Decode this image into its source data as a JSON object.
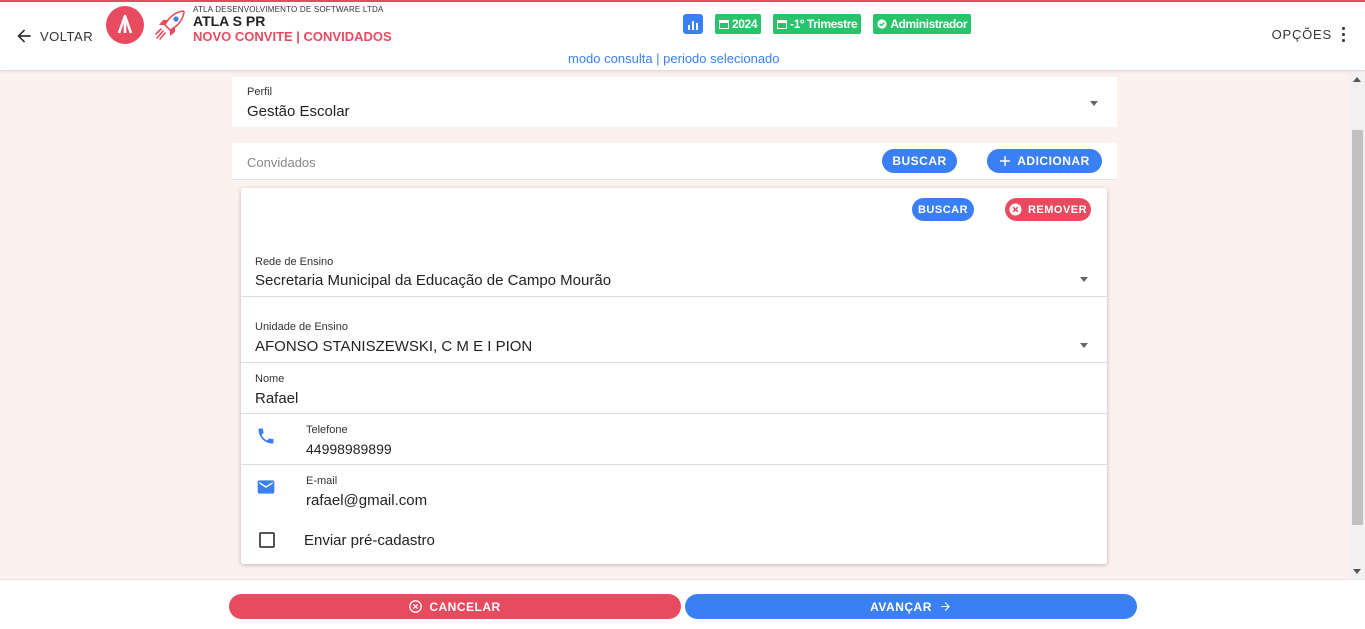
{
  "header": {
    "back_label": "VOLTAR",
    "company": "ATLA DESENVOLVIMENTO DE SOFTWARE LTDA",
    "entity": "ATLA S PR",
    "route": "NOVO CONVITE | CONVIDADOS",
    "badges": {
      "year": "2024",
      "period": "-1º Trimestre",
      "role": "Administrador"
    },
    "mode": "modo consulta | periodo selecionado",
    "options_label": "OPÇÕES"
  },
  "perfil": {
    "label": "Perfil",
    "value": "Gestão Escolar"
  },
  "convidados": {
    "label": "Convidados",
    "search_label": "BUSCAR",
    "add_label": "ADICIONAR"
  },
  "card": {
    "search_label": "BUSCAR",
    "remove_label": "REMOVER",
    "rede": {
      "label": "Rede de Ensino",
      "value": "Secretaria Municipal da Educação de Campo Mourão"
    },
    "unidade": {
      "label": "Unidade de Ensino",
      "value": "AFONSO STANISZEWSKI, C M E I PION"
    },
    "nome": {
      "label": "Nome",
      "value": "Rafael"
    },
    "telefone": {
      "label": "Telefone",
      "value": "44998989899"
    },
    "email": {
      "label": "E-mail",
      "value": "rafael@gmail.com"
    },
    "pre_cadastro": {
      "label": "Enviar pré-cadastro",
      "checked": false
    }
  },
  "footer": {
    "cancel_label": "CANCELAR",
    "next_label": "AVANÇAR"
  },
  "colors": {
    "primary": "#3b7ff5",
    "danger": "#e84a5f",
    "success": "#27c46b",
    "background": "#fdf1f0"
  }
}
